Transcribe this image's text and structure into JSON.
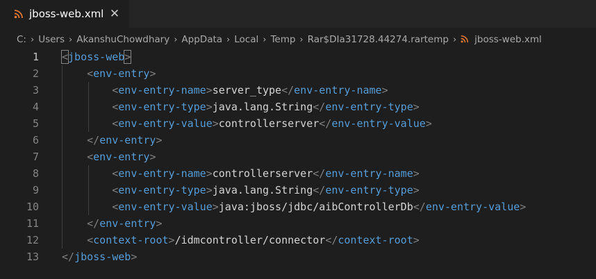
{
  "tab": {
    "title": "jboss-web.xml",
    "icon": "rss-icon",
    "close": "✕"
  },
  "breadcrumb": {
    "items": [
      "C:",
      "Users",
      "AkanshuChowdhary",
      "AppData",
      "Local",
      "Temp",
      "Rar$DIa31728.44274.rartemp"
    ],
    "file": "jboss-web.xml",
    "separator": "›"
  },
  "colors": {
    "background": "#1e1e1e",
    "tag": "#569cd6",
    "bracket": "#808080",
    "text": "#d4d4d4",
    "line_number": "#858585",
    "rss_icon": "#e37933"
  },
  "editor": {
    "active_line": 1,
    "lines": [
      {
        "num": "1",
        "tokens": [
          [
            "br",
            "<"
          ],
          [
            "tag",
            "jboss-web"
          ],
          [
            "br",
            ">"
          ]
        ]
      },
      {
        "num": "2",
        "tokens": [
          [
            "txt",
            "    "
          ],
          [
            "br",
            "<"
          ],
          [
            "tag",
            "env-entry"
          ],
          [
            "br",
            ">"
          ]
        ]
      },
      {
        "num": "3",
        "tokens": [
          [
            "txt",
            "        "
          ],
          [
            "br",
            "<"
          ],
          [
            "tag",
            "env-entry-name"
          ],
          [
            "br",
            ">"
          ],
          [
            "txt",
            "server_type"
          ],
          [
            "br",
            "</"
          ],
          [
            "tag",
            "env-entry-name"
          ],
          [
            "br",
            ">"
          ]
        ]
      },
      {
        "num": "4",
        "tokens": [
          [
            "txt",
            "        "
          ],
          [
            "br",
            "<"
          ],
          [
            "tag",
            "env-entry-type"
          ],
          [
            "br",
            ">"
          ],
          [
            "txt",
            "java.lang.String"
          ],
          [
            "br",
            "</"
          ],
          [
            "tag",
            "env-entry-type"
          ],
          [
            "br",
            ">"
          ]
        ]
      },
      {
        "num": "5",
        "tokens": [
          [
            "txt",
            "        "
          ],
          [
            "br",
            "<"
          ],
          [
            "tag",
            "env-entry-value"
          ],
          [
            "br",
            ">"
          ],
          [
            "txt",
            "controllerserver"
          ],
          [
            "br",
            "</"
          ],
          [
            "tag",
            "env-entry-value"
          ],
          [
            "br",
            ">"
          ]
        ]
      },
      {
        "num": "6",
        "tokens": [
          [
            "txt",
            "    "
          ],
          [
            "br",
            "</"
          ],
          [
            "tag",
            "env-entry"
          ],
          [
            "br",
            ">"
          ]
        ]
      },
      {
        "num": "7",
        "tokens": [
          [
            "txt",
            "    "
          ],
          [
            "br",
            "<"
          ],
          [
            "tag",
            "env-entry"
          ],
          [
            "br",
            ">"
          ]
        ]
      },
      {
        "num": "8",
        "tokens": [
          [
            "txt",
            "        "
          ],
          [
            "br",
            "<"
          ],
          [
            "tag",
            "env-entry-name"
          ],
          [
            "br",
            ">"
          ],
          [
            "txt",
            "controllerserver"
          ],
          [
            "br",
            "</"
          ],
          [
            "tag",
            "env-entry-name"
          ],
          [
            "br",
            ">"
          ]
        ]
      },
      {
        "num": "9",
        "tokens": [
          [
            "txt",
            "        "
          ],
          [
            "br",
            "<"
          ],
          [
            "tag",
            "env-entry-type"
          ],
          [
            "br",
            ">"
          ],
          [
            "txt",
            "java.lang.String"
          ],
          [
            "br",
            "</"
          ],
          [
            "tag",
            "env-entry-type"
          ],
          [
            "br",
            ">"
          ]
        ]
      },
      {
        "num": "10",
        "tokens": [
          [
            "txt",
            "        "
          ],
          [
            "br",
            "<"
          ],
          [
            "tag",
            "env-entry-value"
          ],
          [
            "br",
            ">"
          ],
          [
            "txt",
            "java:jboss/jdbc/aibControllerDb"
          ],
          [
            "br",
            "</"
          ],
          [
            "tag",
            "env-entry-value"
          ],
          [
            "br",
            ">"
          ]
        ]
      },
      {
        "num": "11",
        "tokens": [
          [
            "txt",
            "    "
          ],
          [
            "br",
            "</"
          ],
          [
            "tag",
            "env-entry"
          ],
          [
            "br",
            ">"
          ]
        ]
      },
      {
        "num": "12",
        "tokens": [
          [
            "txt",
            "    "
          ],
          [
            "br",
            "<"
          ],
          [
            "tag",
            "context-root"
          ],
          [
            "br",
            ">"
          ],
          [
            "txt",
            "/idmcontroller/connector"
          ],
          [
            "br",
            "</"
          ],
          [
            "tag",
            "context-root"
          ],
          [
            "br",
            ">"
          ]
        ]
      },
      {
        "num": "13",
        "tokens": [
          [
            "br",
            "</"
          ],
          [
            "tag",
            "jboss-web"
          ],
          [
            "br",
            ">"
          ]
        ]
      }
    ]
  }
}
